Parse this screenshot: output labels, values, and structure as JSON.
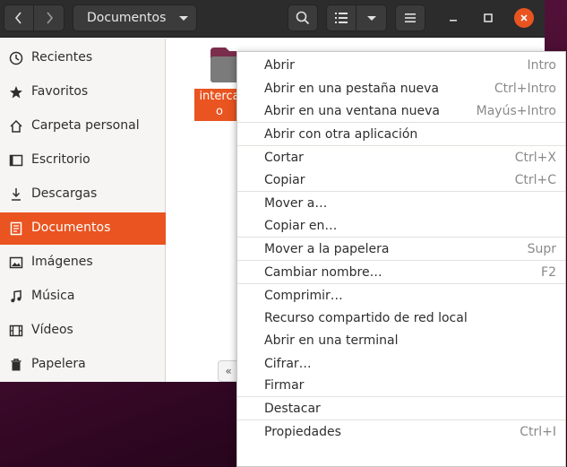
{
  "header": {
    "path_label": "Documentos",
    "icons": [
      "chevron-left-icon",
      "chevron-right-icon",
      "search-icon",
      "list-view-icon",
      "hamburger-icon",
      "minimize-icon",
      "maximize-icon",
      "close-icon"
    ]
  },
  "sidebar": {
    "items": [
      {
        "label": "Recientes",
        "icon": "clock-icon"
      },
      {
        "label": "Favoritos",
        "icon": "star-icon"
      },
      {
        "label": "Carpeta personal",
        "icon": "home-icon"
      },
      {
        "label": "Escritorio",
        "icon": "desktop-icon"
      },
      {
        "label": "Descargas",
        "icon": "download-icon"
      },
      {
        "label": "Documentos",
        "icon": "document-icon"
      },
      {
        "label": "Imágenes",
        "icon": "image-icon"
      },
      {
        "label": "Música",
        "icon": "music-icon"
      },
      {
        "label": "Vídeos",
        "icon": "video-icon"
      },
      {
        "label": "Papelera",
        "icon": "trash-icon"
      }
    ],
    "active_index": 5
  },
  "content": {
    "folder_label_line1": "interca",
    "folder_label_line2": "o",
    "scroll_hint": "«"
  },
  "context_menu": {
    "items": [
      {
        "label": "Abrir",
        "shortcut": "Intro"
      },
      {
        "label": "Abrir en una pestaña nueva",
        "shortcut": "Ctrl+Intro"
      },
      {
        "label": "Abrir en una ventana nueva",
        "shortcut": "Mayús+Intro"
      },
      {
        "label": "Abrir con otra aplicación",
        "shortcut": ""
      },
      {
        "label": "Cortar",
        "shortcut": "Ctrl+X"
      },
      {
        "label": "Copiar",
        "shortcut": "Ctrl+C"
      },
      {
        "label": "Mover a…",
        "shortcut": ""
      },
      {
        "label": "Copiar en…",
        "shortcut": ""
      },
      {
        "label": "Mover a la papelera",
        "shortcut": "Supr"
      },
      {
        "label": "Cambiar nombre…",
        "shortcut": "F2"
      },
      {
        "label": "Comprimir…",
        "shortcut": ""
      },
      {
        "label": "Recurso compartido de red local",
        "shortcut": ""
      },
      {
        "label": "Abrir en una terminal",
        "shortcut": ""
      },
      {
        "label": "Cifrar…",
        "shortcut": ""
      },
      {
        "label": "Firmar",
        "shortcut": ""
      },
      {
        "label": "Destacar",
        "shortcut": ""
      },
      {
        "label": "Propiedades",
        "shortcut": "Ctrl+I"
      }
    ]
  },
  "colors": {
    "accent": "#e95420",
    "headerbar": "#2c2c2c",
    "sidebar_bg": "#f6f5f4"
  }
}
